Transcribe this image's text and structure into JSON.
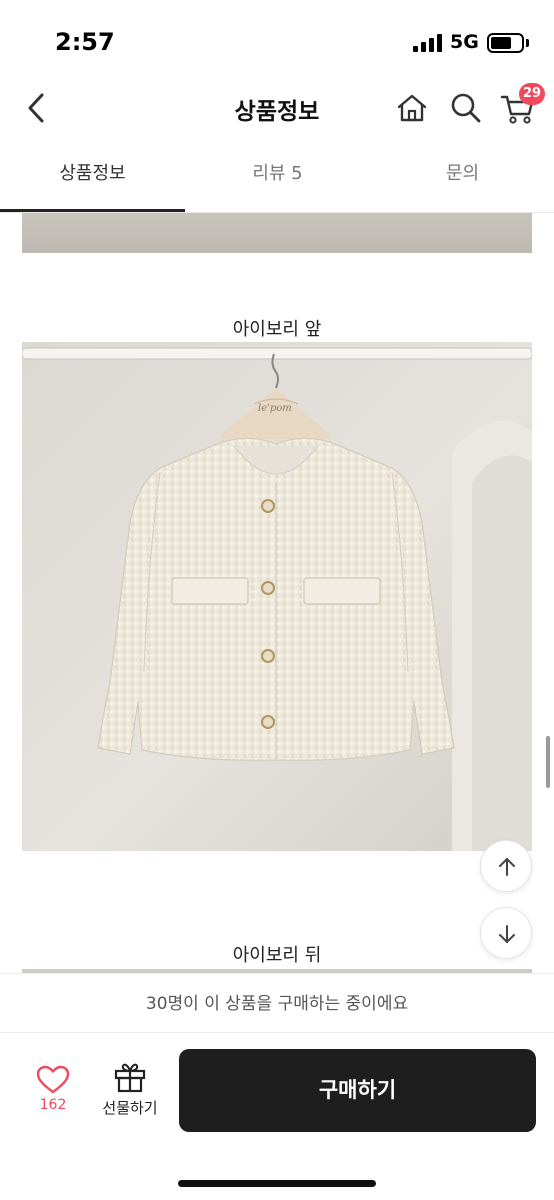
{
  "status_bar": {
    "time": "2:57",
    "network": "5G",
    "battery_level": 0.7
  },
  "nav": {
    "title": "상품정보",
    "icons": [
      "chevron-left-icon",
      "home-icon",
      "search-icon",
      "cart-icon"
    ],
    "cart_count": "29"
  },
  "tabs": [
    {
      "label": "상품정보",
      "active": true
    },
    {
      "label": "리뷰 5",
      "active": false
    },
    {
      "label": "문의",
      "active": false
    }
  ],
  "content": {
    "captions": [
      "아이보리 앞",
      "아이보리 뒤"
    ],
    "hanger_tag_text": "le'pom"
  },
  "scroll_buttons": {
    "up_icon": "arrow-up-icon",
    "down_icon": "arrow-down-icon"
  },
  "bottom": {
    "notice": "30명이 이 상품을 구매하는 중이에요",
    "like_count": "162",
    "gift_label": "선물하기",
    "buy_label": "구매하기"
  },
  "colors": {
    "accent": "#f04a5e",
    "buy_button": "#1e1e1e",
    "tab_indicator": "#222222"
  }
}
